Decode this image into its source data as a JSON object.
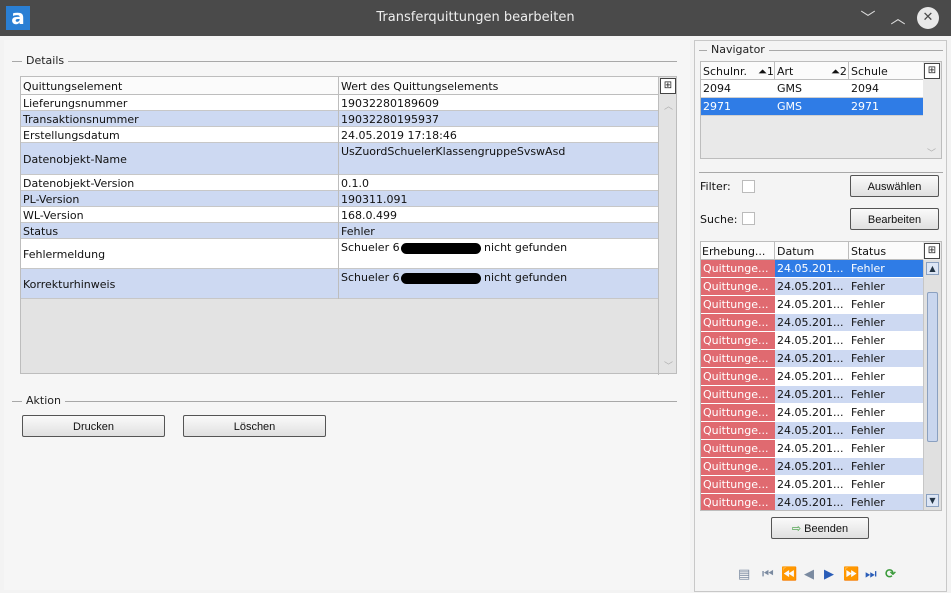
{
  "window": {
    "logo": "a",
    "title": "Transferquittungen bearbeiten",
    "minimize_glyph": "﹀",
    "maximize_glyph": "︿",
    "close_glyph": "✕"
  },
  "details": {
    "group_label": "Details",
    "table_menu_glyph": "⊞",
    "columns": [
      "Quittungselement",
      "Wert des Quittungselements"
    ],
    "rows": [
      {
        "label": "Lieferungsnummer",
        "value": "19032280189609"
      },
      {
        "label": "Transaktionsnummer",
        "value": "19032280195937"
      },
      {
        "label": "Erstellungsdatum",
        "value": "24.05.2019 17:18:46"
      },
      {
        "label": "Datenobjekt-Name",
        "value": "UsZuordSchuelerKlassengruppeSvswAsd"
      },
      {
        "label": "Datenobjekt-Version",
        "value": "0.1.0"
      },
      {
        "label": "PL-Version",
        "value": "190311.091"
      },
      {
        "label": "WL-Version",
        "value": "168.0.499"
      },
      {
        "label": "Status",
        "value": "Fehler"
      },
      {
        "label": "Fehlermeldung",
        "value_prefix": "Schueler 6",
        "value_suffix": "nicht gefunden"
      },
      {
        "label": "Korrekturhinweis",
        "value_prefix": "Schueler 6",
        "value_suffix": "nicht gefunden"
      }
    ]
  },
  "aktion": {
    "group_label": "Aktion",
    "print_button": "Drucken",
    "delete_button": "Löschen"
  },
  "navigator": {
    "group_label": "Navigator",
    "table_menu_glyph": "⊞",
    "columns": [
      {
        "label": "Schulnr.",
        "sort": "1"
      },
      {
        "label": "Art",
        "sort": "2"
      },
      {
        "label": "Schule",
        "sort": ""
      }
    ],
    "rows": [
      {
        "schulnr": "2094",
        "art": "GMS",
        "schule": "2094",
        "selected": false
      },
      {
        "schulnr": "2971",
        "art": "GMS",
        "schule": "2971",
        "selected": true
      }
    ],
    "filter_label": "Filter:",
    "filter_checked": false,
    "search_label": "Suche:",
    "search_checked": false,
    "select_button": "Auswählen",
    "edit_button": "Bearbeiten"
  },
  "log": {
    "table_menu_glyph": "⊞",
    "columns": [
      "Erhebung...",
      "Datum",
      "Status"
    ],
    "rows": [
      {
        "type": "Quittunge...",
        "date": "24.05.201...",
        "status": "Fehler",
        "selected": true
      },
      {
        "type": "Quittunge...",
        "date": "24.05.201...",
        "status": "Fehler"
      },
      {
        "type": "Quittunge...",
        "date": "24.05.201...",
        "status": "Fehler"
      },
      {
        "type": "Quittunge...",
        "date": "24.05.201...",
        "status": "Fehler"
      },
      {
        "type": "Quittunge...",
        "date": "24.05.201...",
        "status": "Fehler"
      },
      {
        "type": "Quittunge...",
        "date": "24.05.201...",
        "status": "Fehler"
      },
      {
        "type": "Quittunge...",
        "date": "24.05.201...",
        "status": "Fehler"
      },
      {
        "type": "Quittunge...",
        "date": "24.05.201...",
        "status": "Fehler"
      },
      {
        "type": "Quittunge...",
        "date": "24.05.201...",
        "status": "Fehler"
      },
      {
        "type": "Quittunge...",
        "date": "24.05.201...",
        "status": "Fehler"
      },
      {
        "type": "Quittunge...",
        "date": "24.05.201...",
        "status": "Fehler"
      },
      {
        "type": "Quittunge...",
        "date": "24.05.201...",
        "status": "Fehler"
      },
      {
        "type": "Quittunge...",
        "date": "24.05.201...",
        "status": "Fehler"
      },
      {
        "type": "Quittunge...",
        "date": "24.05.201...",
        "status": "Fehler"
      }
    ],
    "finish_button": "Beenden"
  },
  "pager": {
    "copy_glyph": "▤",
    "first_glyph": "⏮",
    "prev_page_glyph": "⏪",
    "prev_glyph": "◀",
    "next_glyph": "▶",
    "next_page_glyph": "⏩",
    "last_glyph": "⏭",
    "refresh_glyph": "⟳"
  },
  "colors": {
    "titlebar": "#4a4a4a",
    "selection": "#2f7ce6",
    "alt_row": "#cdd9f2",
    "error_cell": "#e06a70"
  }
}
